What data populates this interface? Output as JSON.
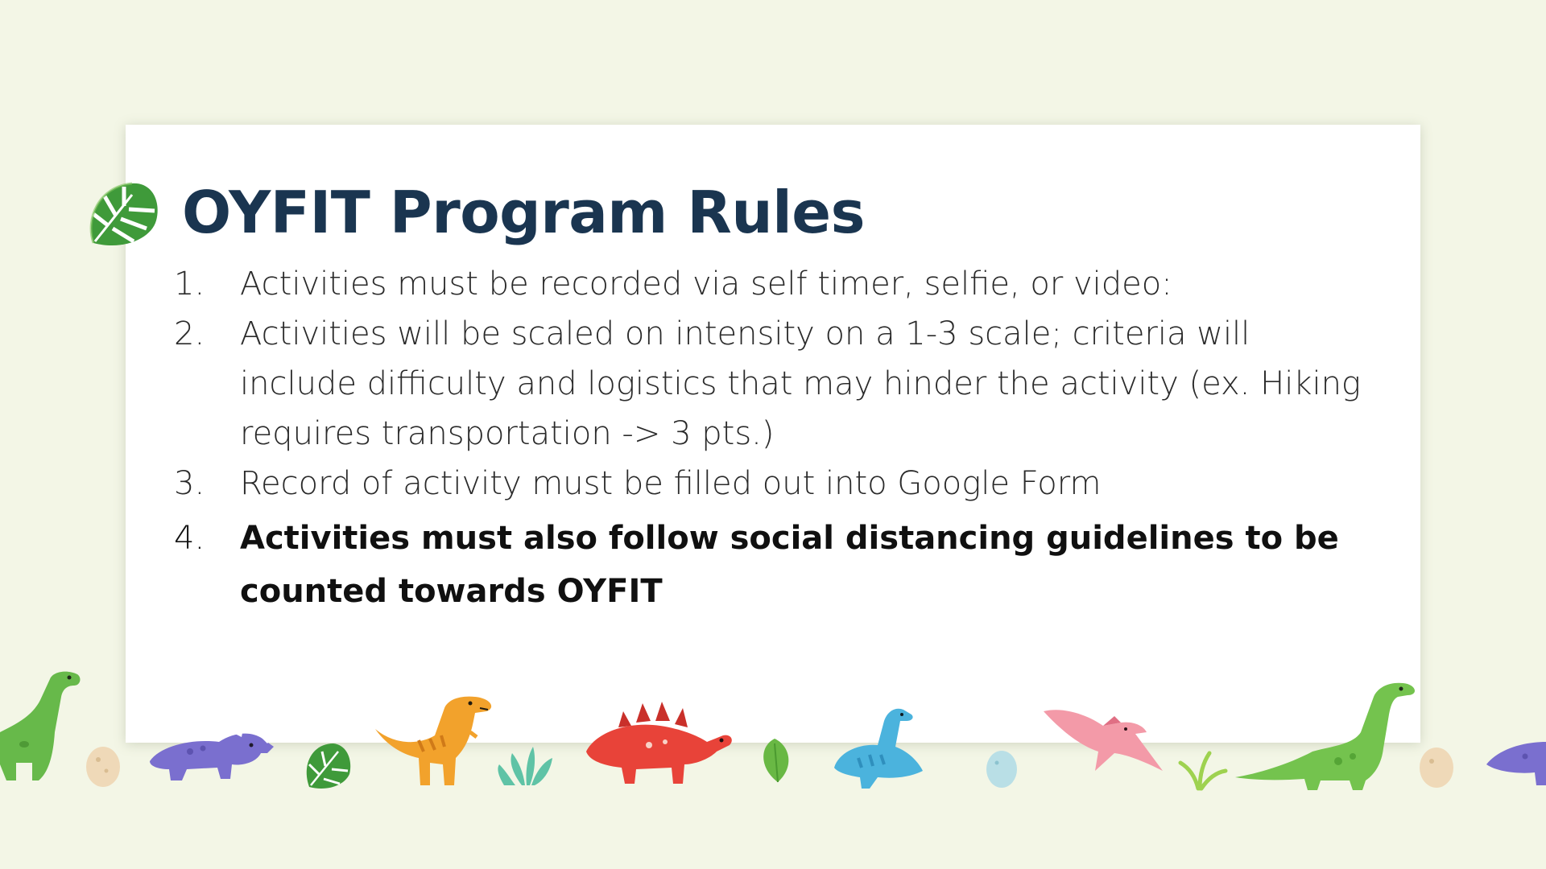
{
  "slide": {
    "title": "OYFIT Program Rules",
    "rules": [
      {
        "number": "1.",
        "text": "Activities must be recorded via self timer, selfie, or video:"
      },
      {
        "number": "2.",
        "text": "Activities will be scaled on intensity on a 1-3 scale; criteria will include difficulty and logistics that may hinder the activity (ex. Hiking requires transportation -> 3 pts.)"
      },
      {
        "number": "3.",
        "text": "Record of activity must be filled out into Google Form"
      },
      {
        "number": "4.",
        "text": "Activities must also follow social distancing guidelines to be counted towards OYFIT"
      }
    ]
  },
  "decor": {
    "title_icon": "monstera-leaf-icon",
    "border_items": [
      "green-brachiosaurus-icon",
      "egg-icon",
      "purple-triceratops-icon",
      "monstera-leaf-icon",
      "orange-t-rex-icon",
      "fern-icon",
      "red-stegosaurus-icon",
      "leaf-icon",
      "blue-plesiosaur-icon",
      "egg-icon",
      "pink-pterodactyl-icon",
      "grass-sprout-icon",
      "green-brachiosaurus-icon",
      "egg-icon",
      "purple-triceratops-icon"
    ]
  },
  "colors": {
    "background": "#f3f6e6",
    "card": "#ffffff",
    "title": "#1a3550",
    "body_text": "#2a2a2a"
  }
}
